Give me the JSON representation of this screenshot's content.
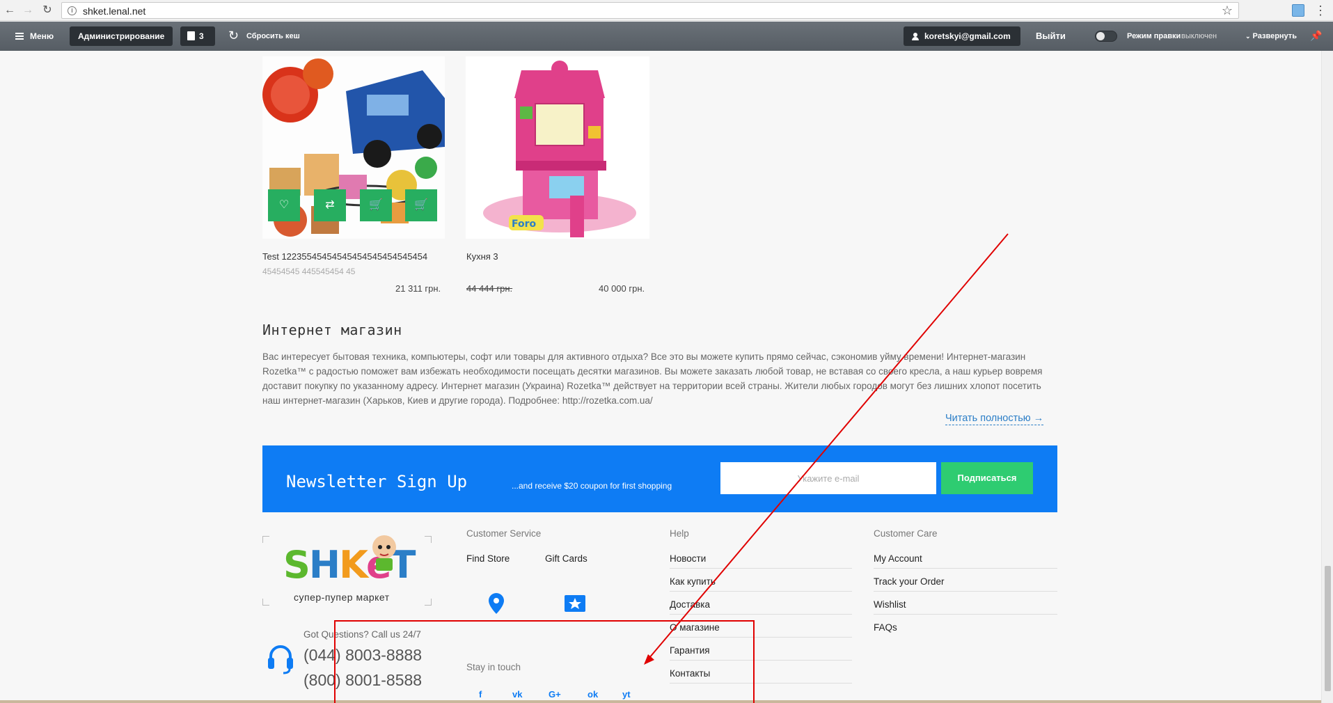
{
  "browser": {
    "url": "shket.lenal.net"
  },
  "admin_bar": {
    "menu_label": "Меню",
    "admin_label": "Администрирование",
    "notifications_count": "3",
    "clear_cache_label": "Сбросить кеш",
    "user_email": "koretskyi@gmail.com",
    "logout_label": "Выйти",
    "edit_mode_label": "Режим правки",
    "edit_mode_state": "выключен",
    "expand_label": "Развернуть"
  },
  "products": [
    {
      "name": "Test 12235545454545454545454545454",
      "desc": "45454545 445545454 45",
      "price": "21 311 грн."
    },
    {
      "name": "Кухня 3",
      "old_price": "44 444 грн.",
      "price": "40 000 грн."
    }
  ],
  "shop": {
    "title": "Интернет магазин",
    "text": "Вас интересует бытовая техника, компьютеры, софт или товары для активного отдыха? Все это вы можете купить прямо сейчас, сэкономив уйму времени! Интернет-магазин Rozetka™ с радостью поможет вам избежать необходимости посещать десятки магазинов. Вы можете заказать любой товар, не вставая со своего кресла, а наш курьер вовремя доставит покупку по указанному адресу. Интернет магазин (Украина) Rozetka™ действует на территории всей страны. Жители любых городов могут без лишних хлопот посетить наш интернет-магазин (Харьков, Киев и другие города). Подробнее: http://rozetka.com.ua/",
    "read_more": "Читать полностью →"
  },
  "newsletter": {
    "title": "Newsletter Sign Up",
    "subtitle": "...and receive $20 coupon for first shopping",
    "placeholder": "Укажите e-mail",
    "button": "Подписаться"
  },
  "footer": {
    "logo_tagline": "супер-пупер маркет",
    "logo_letters": [
      "S",
      "H",
      "K",
      "e",
      "T"
    ],
    "contact_label": "Got Questions? Call us 24/7",
    "phones": [
      "(044) 8003-8888",
      "(800) 8001-8588"
    ],
    "customer_service": {
      "title": "Customer Service",
      "find_store": "Find Store",
      "gift_cards": "Gift Cards"
    },
    "stay_in_touch": "Stay in touch",
    "social": [
      "f",
      "vk",
      "G+",
      "ok",
      "yt"
    ],
    "help": {
      "title": "Help",
      "links": [
        "Новости",
        "Как купить",
        "Доставка",
        "О магазине",
        "Гарантия",
        "Контакты"
      ]
    },
    "customer_care": {
      "title": "Customer Care",
      "links": [
        "My Account",
        "Track your Order",
        "Wishlist",
        "FAQs"
      ]
    }
  },
  "colors": {
    "brand_blue": "#0e7cf4",
    "green": "#27ae60",
    "admin_bar": "#5f666e",
    "annotation_red": "#e00000"
  }
}
